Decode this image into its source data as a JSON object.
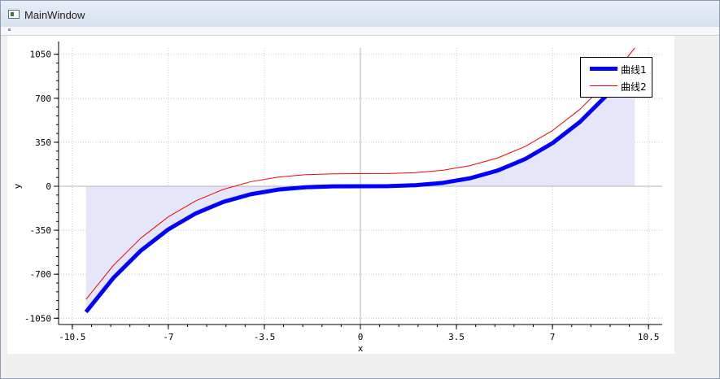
{
  "window": {
    "title": "MainWindow"
  },
  "colors": {
    "curve1": "#0000ff",
    "curve2": "#ff0000",
    "fill": "#e6e6fa",
    "grid": "#c8c8c8",
    "zero_axis": "#b4b4b4"
  },
  "chart_data": {
    "type": "line",
    "title": "",
    "xlabel": "x",
    "ylabel": "y",
    "xlim": [
      -11,
      11
    ],
    "ylim": [
      -1100,
      1100
    ],
    "xticks": [
      -10.5,
      -7,
      -3.5,
      0,
      3.5,
      7,
      10.5
    ],
    "xtick_labels": [
      "-10.5",
      "-7",
      "-3.5",
      "0",
      "3.5",
      "7",
      "10.5"
    ],
    "yticks": [
      1050,
      700,
      350,
      0,
      -350,
      -700,
      -1050
    ],
    "ytick_labels": [
      "1050",
      "700",
      "350",
      "0",
      "-350",
      "-700",
      "-1050"
    ],
    "grid": true,
    "legend_position": "top-right",
    "series": [
      {
        "name": "曲线1",
        "style": "thick line with filled area to zero",
        "x": [
          -10,
          -9,
          -8,
          -7,
          -6,
          -5,
          -4,
          -3,
          -2,
          -1,
          0,
          1,
          2,
          3,
          4,
          5,
          6,
          7,
          8,
          9,
          10
        ],
        "y": [
          -1000,
          -729,
          -512,
          -343,
          -216,
          -125,
          -64,
          -27,
          -8,
          -1,
          0,
          1,
          8,
          27,
          64,
          125,
          216,
          343,
          512,
          729,
          1000
        ]
      },
      {
        "name": "曲线2",
        "style": "thin line",
        "x": [
          -10,
          -9,
          -8,
          -7,
          -6,
          -5,
          -4,
          -3,
          -2,
          -1,
          0,
          1,
          2,
          3,
          4,
          5,
          6,
          7,
          8,
          9,
          10
        ],
        "y": [
          -900,
          -629,
          -412,
          -243,
          -116,
          -25,
          36,
          73,
          92,
          99,
          100,
          101,
          108,
          127,
          164,
          225,
          316,
          443,
          612,
          829,
          1100
        ]
      }
    ]
  }
}
